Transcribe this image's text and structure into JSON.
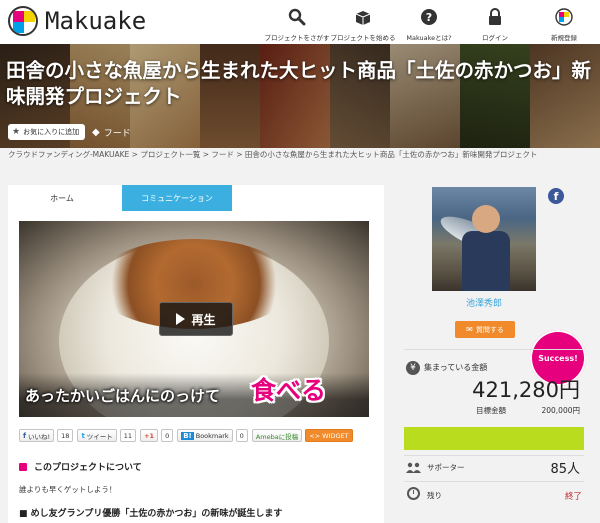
{
  "header": {
    "logo_text": "Makuake",
    "nav": [
      {
        "label": "プロジェクトをさがす",
        "icon": "search-icon"
      },
      {
        "label": "プロジェクトを始める",
        "icon": "box-icon"
      },
      {
        "label": "Makuakeとは?",
        "icon": "question-icon"
      },
      {
        "label": "ログイン",
        "icon": "lock-icon"
      },
      {
        "label": "新規登録",
        "icon": "makuake-logo-icon"
      }
    ]
  },
  "hero": {
    "title": "田舎の小さな魚屋から生まれた大ヒット商品「土佐の赤かつお」新味開発プロジェクト",
    "favorite_label": "お気に入りに追加",
    "category": "フード"
  },
  "breadcrumb": "クラウドファンディング-MAKUAKE > プロジェクト一覧 > フード > 田舎の小さな魚屋から生まれた大ヒット商品「土佐の赤かつお」新味開発プロジェクト",
  "tabs": {
    "home": "ホーム",
    "communication": "コミュニケーション"
  },
  "video": {
    "play_label": "再生",
    "caption": "あったかいごはんにのっけて",
    "caption_emphasis": "食べる"
  },
  "social": {
    "like_label": "いいね!",
    "like_count": "18",
    "tweet_label": "ツイート",
    "tweet_count": "11",
    "gplus_label": "+1",
    "gplus_count": "0",
    "bookmark_label": "Bookmark",
    "bookmark_count": "0",
    "ameba_label": "Amebaに投稿",
    "widget_label": "WIDGET"
  },
  "about": {
    "title": "このプロジェクトについて",
    "lead": "誰よりも早くゲットしよう！",
    "bullet": "■ めし友グランプリ優勝「土佐の赤かつお」の新味が誕生します"
  },
  "owner": {
    "name": "池澤秀郎",
    "question_label": "質問する"
  },
  "stats": {
    "success_badge": "Success!",
    "collected_label": "集まっている金額",
    "collected_amount": "421,280円",
    "target_label": "目標金額",
    "target_amount": "200,000円",
    "progress_fraction": 1.0,
    "supporter_label": "サポーター",
    "supporter_count": "85人",
    "remaining_label": "残り",
    "remaining_value": "終了"
  },
  "colors": {
    "accent_pink": "#e6007e",
    "accent_blue": "#3bb0e0",
    "accent_orange": "#f08a2a",
    "progress_green": "#b9dc1e",
    "ended_red": "#c0272d"
  }
}
